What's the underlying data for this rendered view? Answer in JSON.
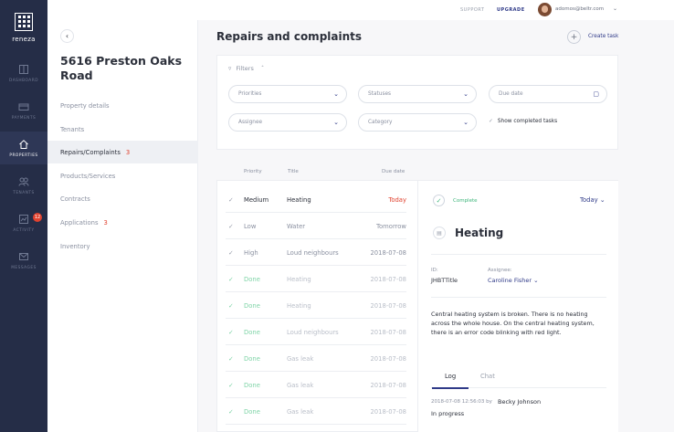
{
  "nav": {
    "logo": "reneza",
    "items": [
      {
        "label": "DASHBOARD",
        "icon": "dashboard-icon"
      },
      {
        "label": "PAYMENTS",
        "icon": "payments-icon"
      },
      {
        "label": "PROPERTIES",
        "icon": "home-icon"
      },
      {
        "label": "TENANTS",
        "icon": "tenants-icon"
      },
      {
        "label": "ACTIVITY",
        "icon": "activity-icon",
        "badge": "12"
      },
      {
        "label": "MESSAGES",
        "icon": "messages-icon"
      }
    ]
  },
  "topbar": {
    "support": "SUPPORT",
    "upgrade": "UPGRADE",
    "email": "adomos@beltr.com"
  },
  "property": {
    "title": "5616 Preston Oaks Road",
    "menu": [
      {
        "label": "Property details"
      },
      {
        "label": "Tenants"
      },
      {
        "label": "Repairs/Complaints",
        "count": "3"
      },
      {
        "label": "Products/Services"
      },
      {
        "label": "Contracts"
      },
      {
        "label": "Applications",
        "count": "3"
      },
      {
        "label": "Inventory"
      }
    ]
  },
  "main": {
    "title": "Repairs and complaints",
    "create_label": "Create task"
  },
  "filters": {
    "label": "Filters",
    "priorities": "Priorities",
    "statuses": "Statuses",
    "due_date": "Due date",
    "assignee": "Assignee",
    "category": "Category",
    "show_completed": "Show completed tasks"
  },
  "list": {
    "headers": {
      "priority": "Priority",
      "title": "Title",
      "due": "Due date"
    },
    "rows": [
      {
        "priority": "Medium",
        "title": "Heating",
        "due": "Today"
      },
      {
        "priority": "Low",
        "title": "Water",
        "due": "Tomorrow"
      },
      {
        "priority": "High",
        "title": "Loud neighbours",
        "due": "2018-07-08"
      },
      {
        "priority": "Done",
        "title": "Heating",
        "due": "2018-07-08"
      },
      {
        "priority": "Done",
        "title": "Heating",
        "due": "2018-07-08"
      },
      {
        "priority": "Done",
        "title": "Loud neighbours",
        "due": "2018-07-08"
      },
      {
        "priority": "Done",
        "title": "Gas leak",
        "due": "2018-07-08"
      },
      {
        "priority": "Done",
        "title": "Gas leak",
        "due": "2018-07-08"
      },
      {
        "priority": "Done",
        "title": "Gas leak",
        "due": "2018-07-08"
      }
    ]
  },
  "detail": {
    "status": "Complete",
    "due": "Today",
    "title": "Heating",
    "id_label": "ID:",
    "id_value": "JHBTTitle",
    "assignee_label": "Assignee:",
    "assignee_value": "Caroline Fisher",
    "description": "Central heating system is broken. There is no heating across the whole house. On the central heating system, there is an error code blinking with red light.",
    "tabs": [
      "Log",
      "Chat"
    ],
    "log": {
      "time": "2018-07-08 12:56:03 by",
      "author": "Becky Johnson",
      "text": "In progress"
    }
  },
  "colors": {
    "nav_bg": "#252d47",
    "accent": "#2f3a88",
    "danger": "#e0422f",
    "success": "#3db57a"
  }
}
